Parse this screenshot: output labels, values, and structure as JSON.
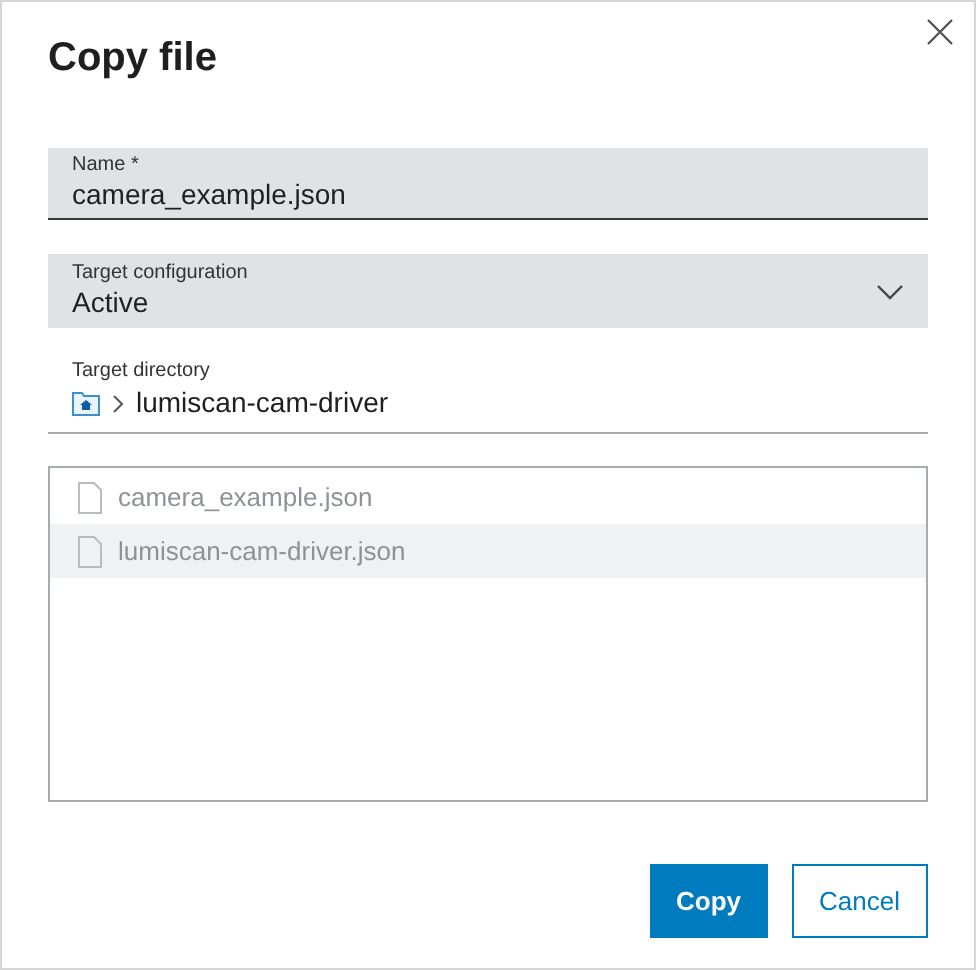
{
  "dialog": {
    "title": "Copy file"
  },
  "name_field": {
    "label": "Name *",
    "value": "camera_example.json"
  },
  "target_configuration": {
    "label": "Target configuration",
    "value": "Active"
  },
  "target_directory": {
    "label": "Target directory",
    "path": [
      {
        "kind": "home"
      },
      {
        "kind": "folder",
        "label": "lumiscan-cam-driver"
      }
    ]
  },
  "files": [
    {
      "name": "camera_example.json",
      "selected": false
    },
    {
      "name": "lumiscan-cam-driver.json",
      "selected": true
    }
  ],
  "buttons": [
    {
      "label": "Copy",
      "kind": "primary"
    },
    {
      "label": "Cancel",
      "kind": "secondary"
    }
  ]
}
